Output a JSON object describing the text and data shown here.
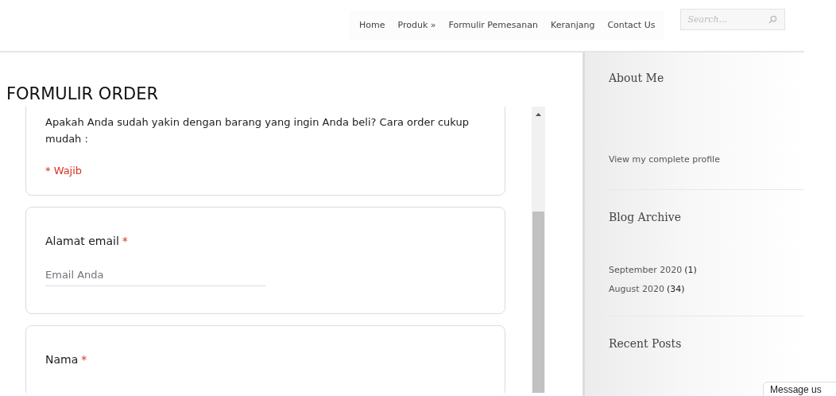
{
  "nav": {
    "items": [
      {
        "label": "Home"
      },
      {
        "label": "Produk »"
      },
      {
        "label": "Formulir Pemesanan"
      },
      {
        "label": "Keranjang"
      },
      {
        "label": "Contact Us"
      }
    ],
    "search": {
      "placeholder": "Search..."
    }
  },
  "page_title": "FORMULIR ORDER",
  "form": {
    "intro": "Apakah Anda sudah yakin dengan barang yang ingin Anda beli? Cara order cukup mudah :",
    "required_note": "* Wajib",
    "questions": [
      {
        "label": "Alamat email",
        "required_mark": "*",
        "placeholder": "Email Anda"
      },
      {
        "label": "Nama",
        "required_mark": "*"
      }
    ]
  },
  "sidebar": {
    "widgets": [
      {
        "title": "About Me",
        "links": [
          {
            "text": "View my complete profile"
          }
        ]
      },
      {
        "title": "Blog Archive",
        "links": [
          {
            "text": "September 2020",
            "count": "(1)"
          },
          {
            "text": "August 2020",
            "count": "(34)"
          }
        ]
      },
      {
        "title": "Recent Posts"
      }
    ]
  },
  "message_button": "Message us"
}
